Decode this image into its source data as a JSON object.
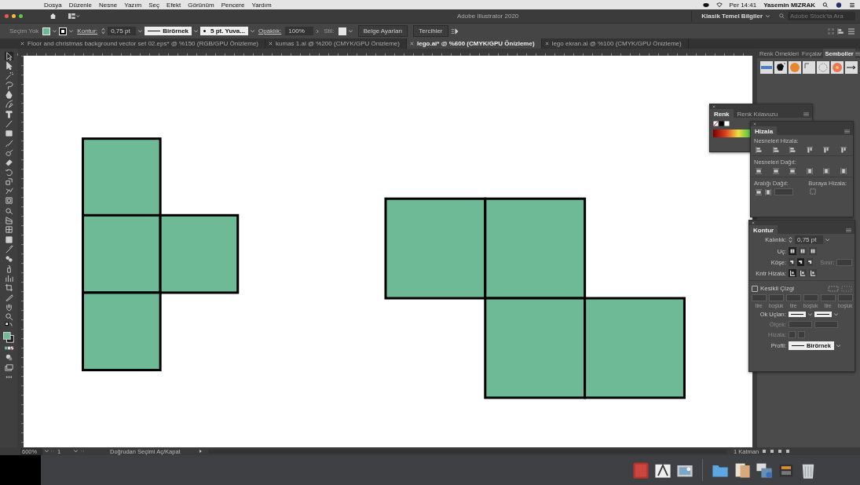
{
  "menu_bar": {
    "items": [
      "Dosya",
      "Düzenle",
      "Nesne",
      "Yazım",
      "Seç",
      "Efekt",
      "Görünüm",
      "Pencere",
      "Yardım"
    ],
    "clock": "Per 14:41",
    "user": "Yasemin MIZRAK"
  },
  "title_bar": {
    "title": "Adobe Illustrator 2020",
    "workspace": "Klasik Temel Bilgiler",
    "search": {
      "placeholder": "Adobe Stock'ta Ara"
    }
  },
  "control_bar": {
    "selection": "Seçim Yok",
    "stroke_label": "Kontur:",
    "stroke_weight": "0,75 pt",
    "stroke_profile": "Birörnek",
    "brush": "5 pt. Yuva...",
    "opacity_label": "Opaklık:",
    "opacity": "100%",
    "style_label": "Stil:",
    "buttons": [
      "Belge Ayarları",
      "Tercihler"
    ]
  },
  "document_tabs": [
    {
      "label": "Floor and christmas background vector set 02.eps* @ %150 (RGB/GPU Önizleme)",
      "selected": false
    },
    {
      "label": "kumas 1.ai @ %200 (CMYK/GPU Önizleme)",
      "selected": false
    },
    {
      "label": "lego.ai* @ %600 (CMYK/GPU Önizleme)",
      "selected": true
    },
    {
      "label": "lego ekran.ai @ %100 (CMYK/GPU Önizleme)",
      "selected": false
    }
  ],
  "panel_dock": {
    "tabs": [
      {
        "label": "Renk Örnekleri",
        "selected": false
      },
      {
        "label": "Fırçalar",
        "selected": false
      },
      {
        "label": "Semboller",
        "selected": true
      }
    ]
  },
  "color_panel": {
    "tabs": [
      {
        "label": "Renk",
        "selected": true
      },
      {
        "label": "Renk Kılavuzu",
        "selected": false
      }
    ]
  },
  "align_panel": {
    "title": "Hizala",
    "align_objects": "Nesneleri Hizala:",
    "distribute_objects": "Nesneleri Dağıt:",
    "distribute_spacing": "Aralığı Dağıt:",
    "align_to": "Buraya Hizala:"
  },
  "stroke_panel": {
    "title": "Kontur",
    "weight_label": "Kalınlık:",
    "weight": "0,75 pt",
    "cap_label": "Uç:",
    "caps": [
      {
        "selected": true
      },
      {
        "selected": false
      },
      {
        "selected": false
      }
    ],
    "corner_label": "Köşe:",
    "corners": [
      {
        "selected": false
      },
      {
        "selected": true
      },
      {
        "selected": false
      }
    ],
    "limit_label": "Sınır:",
    "align_label": "Kntr Hizala:",
    "aligns": [
      {
        "selected": true
      },
      {
        "selected": false
      },
      {
        "selected": false
      }
    ],
    "dashed": {
      "label": "Kesikli Çizgi",
      "checked": false
    },
    "dash_labels": [
      "tire",
      "boşluk",
      "tire",
      "boşluk",
      "tire",
      "boşluk"
    ],
    "arrowheads_label": "Ok Uçları:",
    "scale_label": "Ölçek:",
    "arrow_align_label": "Hizala:",
    "profile_label": "Profil:",
    "profile": "Birörnek"
  },
  "status_bar": {
    "zoom": "600%",
    "page": "1",
    "tool_hint": "Doğrudan Seçimi Aç/Kapat",
    "layers": "1 Katman"
  }
}
